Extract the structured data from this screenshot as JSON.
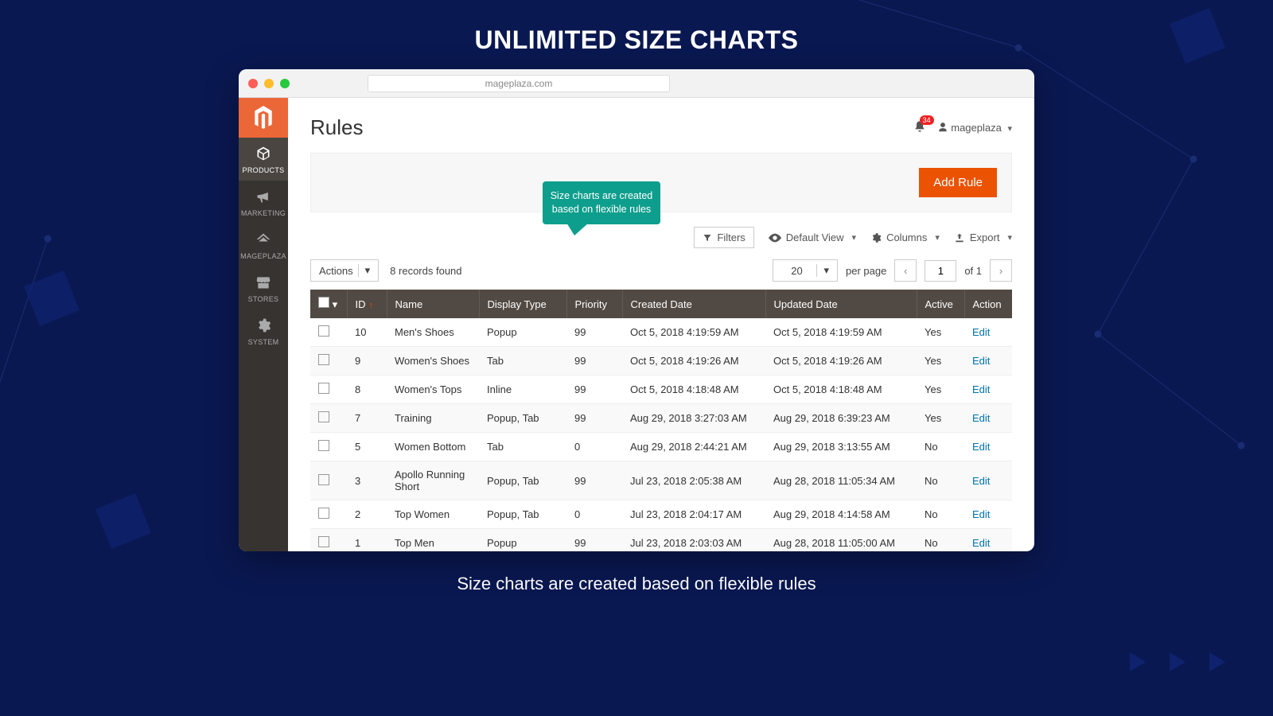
{
  "hero": {
    "title": "UNLIMITED SIZE CHARTS",
    "subtitle": "Size charts are created based on flexible rules"
  },
  "browser": {
    "url": "mageplaza.com"
  },
  "sidebar": {
    "items": [
      {
        "label": "PRODUCTS",
        "icon": "cube-icon",
        "active": true
      },
      {
        "label": "MARKETING",
        "icon": "megaphone-icon",
        "active": false
      },
      {
        "label": "MAGEPLAZA",
        "icon": "roof-icon",
        "active": false
      },
      {
        "label": "STORES",
        "icon": "store-icon",
        "active": false
      },
      {
        "label": "SYSTEM",
        "icon": "gear-icon",
        "active": false
      }
    ]
  },
  "header": {
    "page_title": "Rules",
    "notif_count": "34",
    "user_name": "mageplaza"
  },
  "actions": {
    "add_rule": "Add Rule"
  },
  "callout": "Size charts are created based on flexible rules",
  "toolbar": {
    "filters": "Filters",
    "view_label": "Default View",
    "columns": "Columns",
    "export": "Export"
  },
  "listbar": {
    "actions": "Actions",
    "records_found": "8 records found",
    "page_size": "20",
    "per_page": "per page",
    "page": "1",
    "of": "of 1"
  },
  "columns": [
    "ID",
    "Name",
    "Display Type",
    "Priority",
    "Created Date",
    "Updated Date",
    "Active",
    "Action"
  ],
  "rows": [
    {
      "id": "10",
      "name": "Men's Shoes",
      "display": "Popup",
      "priority": "99",
      "created": "Oct 5, 2018 4:19:59 AM",
      "updated": "Oct 5, 2018 4:19:59 AM",
      "active": "Yes",
      "action": "Edit"
    },
    {
      "id": "9",
      "name": "Women's Shoes",
      "display": "Tab",
      "priority": "99",
      "created": "Oct 5, 2018 4:19:26 AM",
      "updated": "Oct 5, 2018 4:19:26 AM",
      "active": "Yes",
      "action": "Edit"
    },
    {
      "id": "8",
      "name": "Women's Tops",
      "display": "Inline",
      "priority": "99",
      "created": "Oct 5, 2018 4:18:48 AM",
      "updated": "Oct 5, 2018 4:18:48 AM",
      "active": "Yes",
      "action": "Edit"
    },
    {
      "id": "7",
      "name": "Training",
      "display": "Popup, Tab",
      "priority": "99",
      "created": "Aug 29, 2018 3:27:03 AM",
      "updated": "Aug 29, 2018 6:39:23 AM",
      "active": "Yes",
      "action": "Edit"
    },
    {
      "id": "5",
      "name": "Women Bottom",
      "display": "Tab",
      "priority": "0",
      "created": "Aug 29, 2018 2:44:21 AM",
      "updated": "Aug 29, 2018 3:13:55 AM",
      "active": "No",
      "action": "Edit"
    },
    {
      "id": "3",
      "name": "Apollo Running Short",
      "display": "Popup, Tab",
      "priority": "99",
      "created": "Jul 23, 2018 2:05:38 AM",
      "updated": "Aug 28, 2018 11:05:34 AM",
      "active": "No",
      "action": "Edit"
    },
    {
      "id": "2",
      "name": "Top Women",
      "display": "Popup, Tab",
      "priority": "0",
      "created": "Jul 23, 2018 2:04:17 AM",
      "updated": "Aug 29, 2018 4:14:58 AM",
      "active": "No",
      "action": "Edit"
    },
    {
      "id": "1",
      "name": "Top Men",
      "display": "Popup",
      "priority": "99",
      "created": "Jul 23, 2018 2:03:03 AM",
      "updated": "Aug 28, 2018 11:05:00 AM",
      "active": "No",
      "action": "Edit"
    }
  ]
}
